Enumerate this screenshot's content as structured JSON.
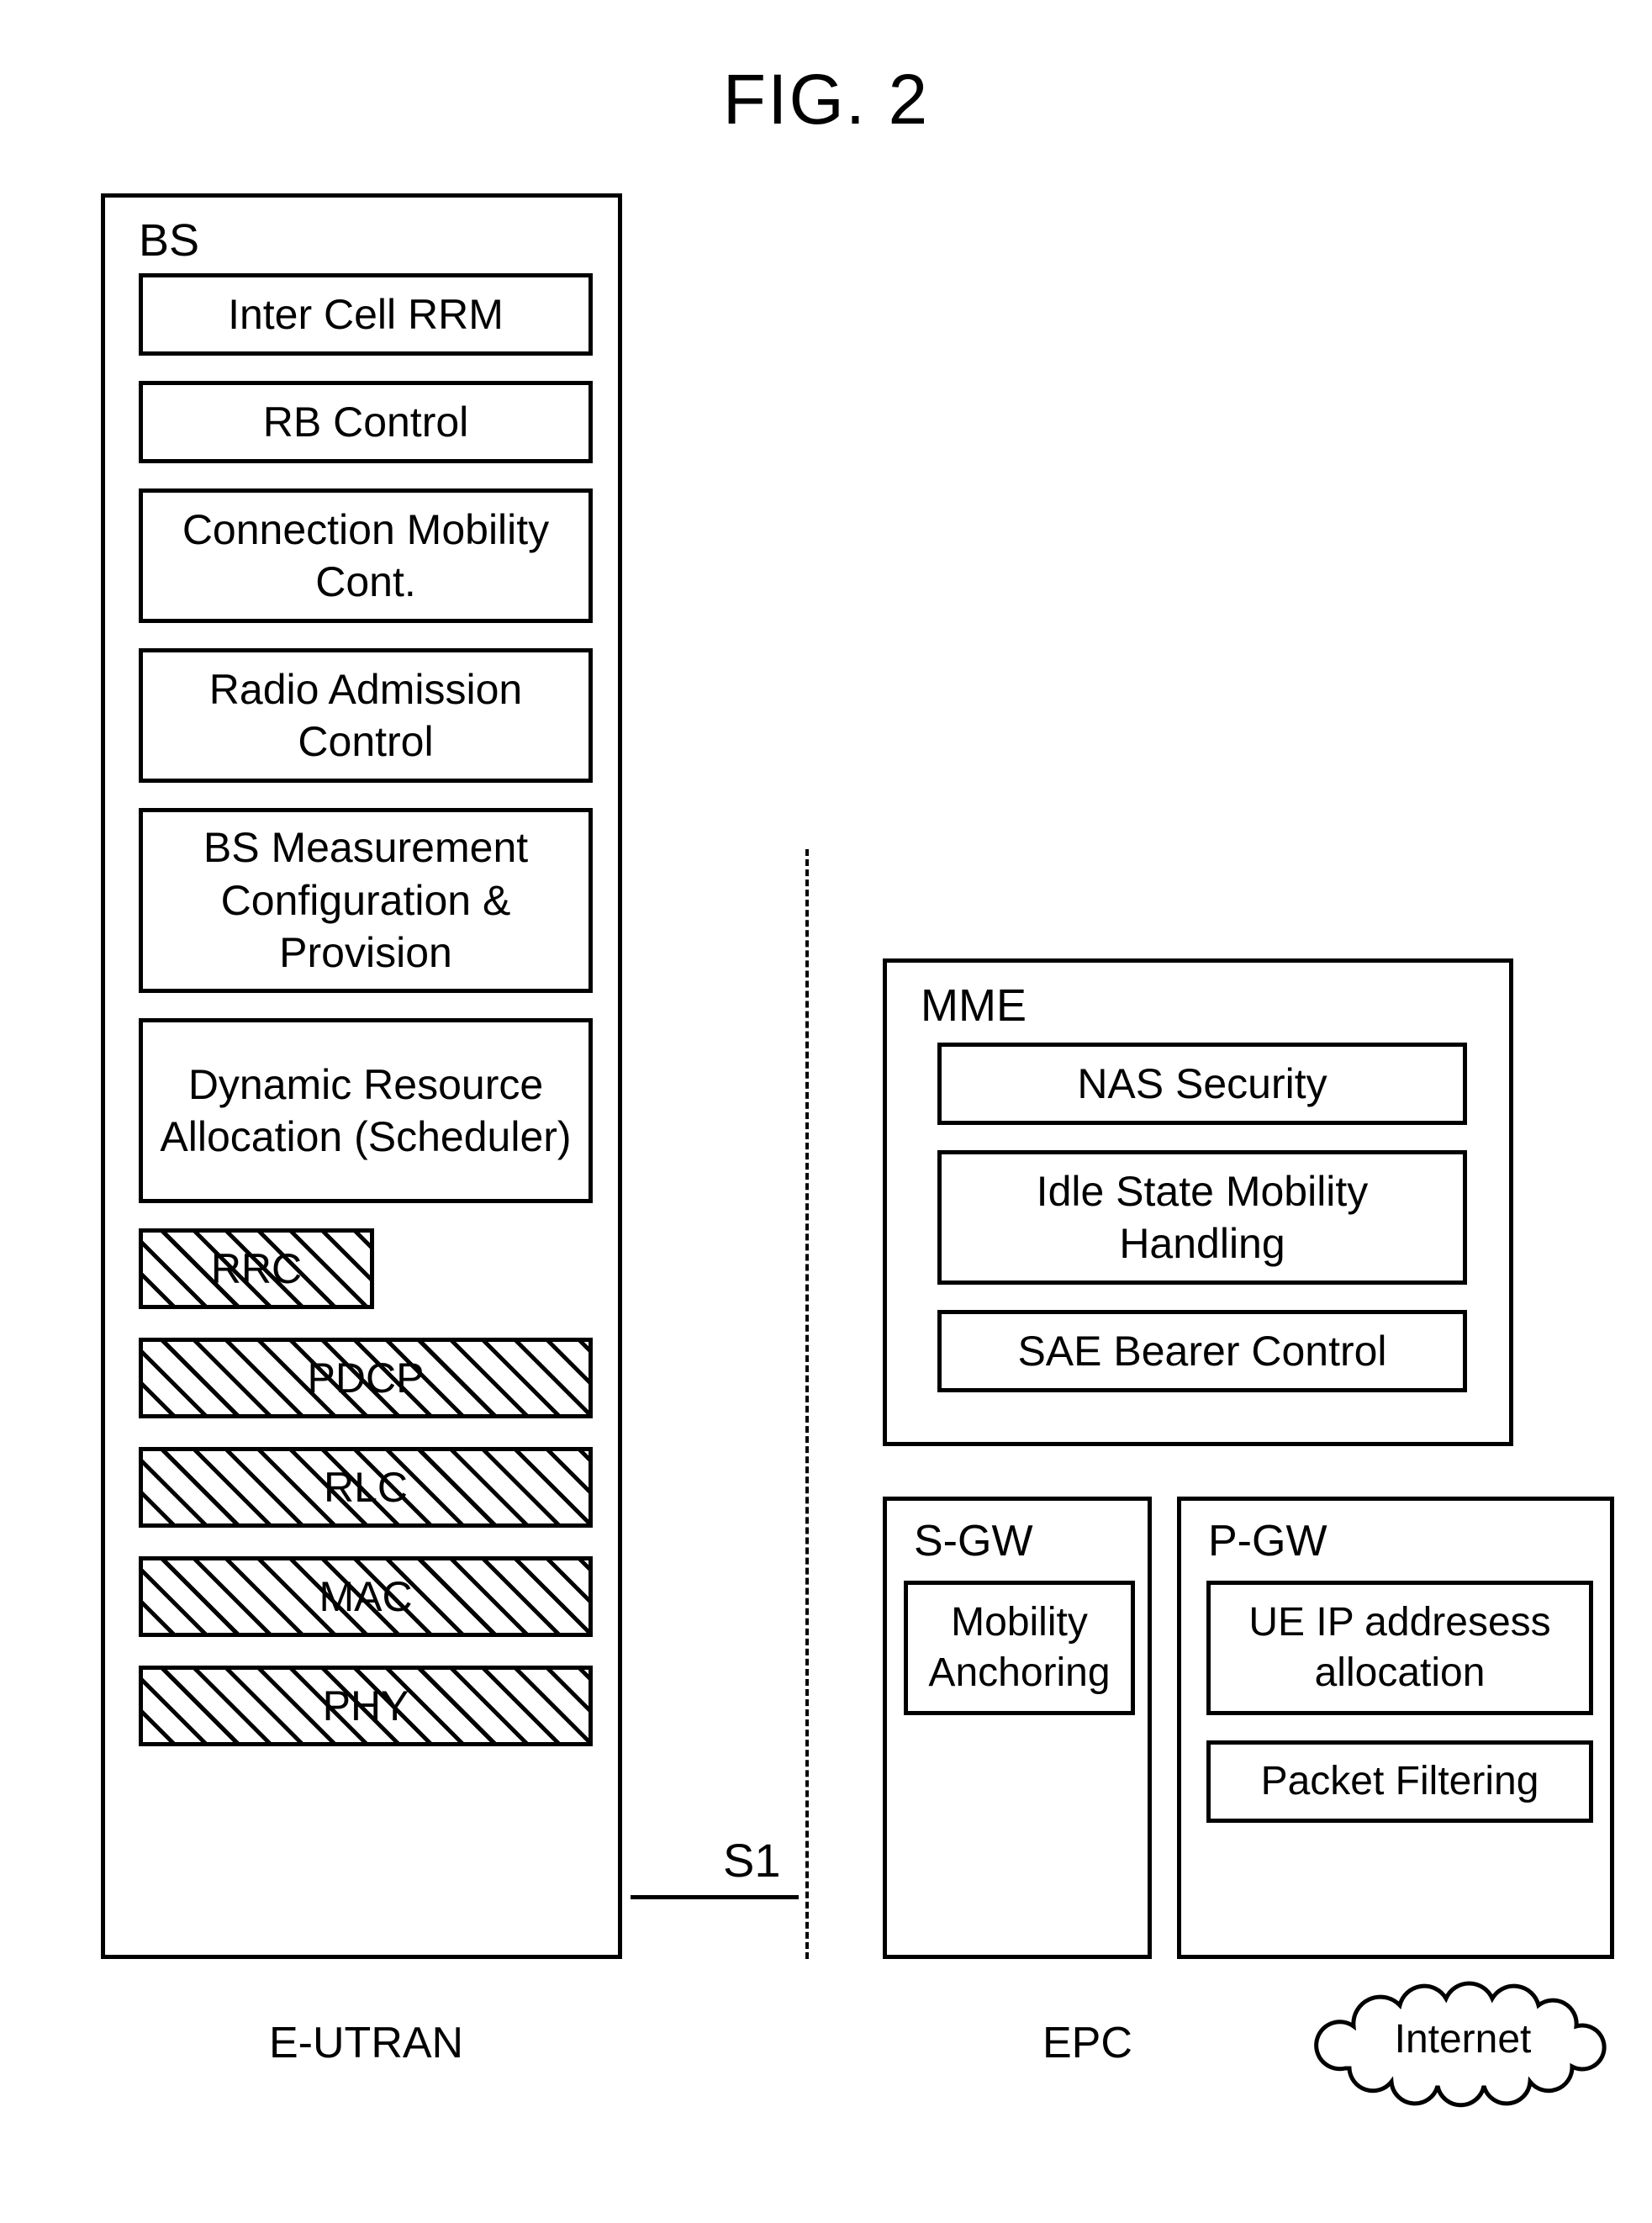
{
  "figure_title": "FIG. 2",
  "bs": {
    "label": "BS",
    "plain_items": [
      "Inter Cell RRM",
      "RB Control",
      "Connection Mobility Cont.",
      "Radio Admission Control",
      "BS Measurement Configuration & Provision",
      "Dynamic Resource Allocation (Scheduler)"
    ],
    "hatched_items": [
      "RRC",
      "PDCP",
      "RLC",
      "MAC",
      "PHY"
    ]
  },
  "interface_label": "S1",
  "mme": {
    "label": "MME",
    "items": [
      "NAS Security",
      "Idle State Mobility Handling",
      "SAE Bearer Control"
    ]
  },
  "sgw": {
    "label": "S-GW",
    "items": [
      "Mobility Anchoring"
    ]
  },
  "pgw": {
    "label": "P-GW",
    "items": [
      "UE IP addresess allocation",
      "Packet Filtering"
    ]
  },
  "bottom_labels": {
    "left": "E-UTRAN",
    "center": "EPC",
    "cloud": "Internet"
  }
}
